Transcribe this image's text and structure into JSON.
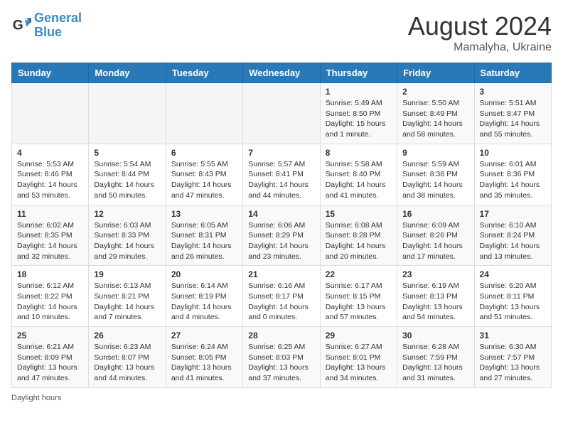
{
  "logo": {
    "line1": "General",
    "line2": "Blue"
  },
  "title": "August 2024",
  "subtitle": "Mamalyha, Ukraine",
  "days_of_week": [
    "Sunday",
    "Monday",
    "Tuesday",
    "Wednesday",
    "Thursday",
    "Friday",
    "Saturday"
  ],
  "weeks": [
    [
      {
        "day": "",
        "info": ""
      },
      {
        "day": "",
        "info": ""
      },
      {
        "day": "",
        "info": ""
      },
      {
        "day": "",
        "info": ""
      },
      {
        "day": "1",
        "info": "Sunrise: 5:49 AM\nSunset: 8:50 PM\nDaylight: 15 hours\nand 1 minute."
      },
      {
        "day": "2",
        "info": "Sunrise: 5:50 AM\nSunset: 8:49 PM\nDaylight: 14 hours\nand 58 minutes."
      },
      {
        "day": "3",
        "info": "Sunrise: 5:51 AM\nSunset: 8:47 PM\nDaylight: 14 hours\nand 55 minutes."
      }
    ],
    [
      {
        "day": "4",
        "info": "Sunrise: 5:53 AM\nSunset: 8:46 PM\nDaylight: 14 hours\nand 53 minutes."
      },
      {
        "day": "5",
        "info": "Sunrise: 5:54 AM\nSunset: 8:44 PM\nDaylight: 14 hours\nand 50 minutes."
      },
      {
        "day": "6",
        "info": "Sunrise: 5:55 AM\nSunset: 8:43 PM\nDaylight: 14 hours\nand 47 minutes."
      },
      {
        "day": "7",
        "info": "Sunrise: 5:57 AM\nSunset: 8:41 PM\nDaylight: 14 hours\nand 44 minutes."
      },
      {
        "day": "8",
        "info": "Sunrise: 5:58 AM\nSunset: 8:40 PM\nDaylight: 14 hours\nand 41 minutes."
      },
      {
        "day": "9",
        "info": "Sunrise: 5:59 AM\nSunset: 8:38 PM\nDaylight: 14 hours\nand 38 minutes."
      },
      {
        "day": "10",
        "info": "Sunrise: 6:01 AM\nSunset: 8:36 PM\nDaylight: 14 hours\nand 35 minutes."
      }
    ],
    [
      {
        "day": "11",
        "info": "Sunrise: 6:02 AM\nSunset: 8:35 PM\nDaylight: 14 hours\nand 32 minutes."
      },
      {
        "day": "12",
        "info": "Sunrise: 6:03 AM\nSunset: 8:33 PM\nDaylight: 14 hours\nand 29 minutes."
      },
      {
        "day": "13",
        "info": "Sunrise: 6:05 AM\nSunset: 8:31 PM\nDaylight: 14 hours\nand 26 minutes."
      },
      {
        "day": "14",
        "info": "Sunrise: 6:06 AM\nSunset: 8:29 PM\nDaylight: 14 hours\nand 23 minutes."
      },
      {
        "day": "15",
        "info": "Sunrise: 6:08 AM\nSunset: 8:28 PM\nDaylight: 14 hours\nand 20 minutes."
      },
      {
        "day": "16",
        "info": "Sunrise: 6:09 AM\nSunset: 8:26 PM\nDaylight: 14 hours\nand 17 minutes."
      },
      {
        "day": "17",
        "info": "Sunrise: 6:10 AM\nSunset: 8:24 PM\nDaylight: 14 hours\nand 13 minutes."
      }
    ],
    [
      {
        "day": "18",
        "info": "Sunrise: 6:12 AM\nSunset: 8:22 PM\nDaylight: 14 hours\nand 10 minutes."
      },
      {
        "day": "19",
        "info": "Sunrise: 6:13 AM\nSunset: 8:21 PM\nDaylight: 14 hours\nand 7 minutes."
      },
      {
        "day": "20",
        "info": "Sunrise: 6:14 AM\nSunset: 8:19 PM\nDaylight: 14 hours\nand 4 minutes."
      },
      {
        "day": "21",
        "info": "Sunrise: 6:16 AM\nSunset: 8:17 PM\nDaylight: 14 hours\nand 0 minutes."
      },
      {
        "day": "22",
        "info": "Sunrise: 6:17 AM\nSunset: 8:15 PM\nDaylight: 13 hours\nand 57 minutes."
      },
      {
        "day": "23",
        "info": "Sunrise: 6:19 AM\nSunset: 8:13 PM\nDaylight: 13 hours\nand 54 minutes."
      },
      {
        "day": "24",
        "info": "Sunrise: 6:20 AM\nSunset: 8:11 PM\nDaylight: 13 hours\nand 51 minutes."
      }
    ],
    [
      {
        "day": "25",
        "info": "Sunrise: 6:21 AM\nSunset: 8:09 PM\nDaylight: 13 hours\nand 47 minutes."
      },
      {
        "day": "26",
        "info": "Sunrise: 6:23 AM\nSunset: 8:07 PM\nDaylight: 13 hours\nand 44 minutes."
      },
      {
        "day": "27",
        "info": "Sunrise: 6:24 AM\nSunset: 8:05 PM\nDaylight: 13 hours\nand 41 minutes."
      },
      {
        "day": "28",
        "info": "Sunrise: 6:25 AM\nSunset: 8:03 PM\nDaylight: 13 hours\nand 37 minutes."
      },
      {
        "day": "29",
        "info": "Sunrise: 6:27 AM\nSunset: 8:01 PM\nDaylight: 13 hours\nand 34 minutes."
      },
      {
        "day": "30",
        "info": "Sunrise: 6:28 AM\nSunset: 7:59 PM\nDaylight: 13 hours\nand 31 minutes."
      },
      {
        "day": "31",
        "info": "Sunrise: 6:30 AM\nSunset: 7:57 PM\nDaylight: 13 hours\nand 27 minutes."
      }
    ]
  ],
  "footer": "Daylight hours"
}
